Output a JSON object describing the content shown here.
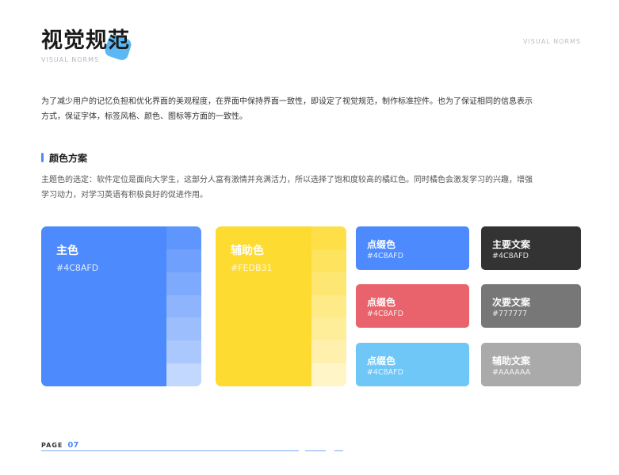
{
  "header": {
    "title": "视觉规范",
    "subtitle": "VISUAL NORMS",
    "corner_label": "VISUAL NORMS",
    "blob_color": "#5bb8f5"
  },
  "intro": "为了减少用户的记忆负担和优化界面的美观程度，在界面中保持界面一致性，即设定了视觉规范，制作标准控件。也为了保证相同的信息表示方式，保证字体，标签风格、颜色、图标等方面的一致性。",
  "section": {
    "title": "颜色方案",
    "desc": "主题色的选定：软件定位是面向大学生，这部分人富有激情并充满活力，所以选择了饱和度较高的橘红色。同时橘色会激发学习的兴趣，增强学习动力，对学习英语有积极良好的促进作用。",
    "accent": "#4c8afd"
  },
  "primary": {
    "name": "主色",
    "hex": "#4C8AFD",
    "color": "#4c8afd",
    "shades": [
      "#5f96fd",
      "#6fa0fd",
      "#7eaafd",
      "#8db4fd",
      "#9cbefd",
      "#abc8fe",
      "#c2d8fe"
    ]
  },
  "secondary": {
    "name": "辅助色",
    "hex": "#FEDB31",
    "color": "#fedb31",
    "shades": [
      "#fedf48",
      "#fee35e",
      "#fee672",
      "#feea86",
      "#feed99",
      "#fff1ad",
      "#fff5c6"
    ]
  },
  "accents": [
    {
      "name": "点缀色",
      "hex": "#4C8AFD",
      "color": "#4c8afd"
    },
    {
      "name": "点缀色",
      "hex": "#4C8AFD",
      "color": "#e8636b"
    },
    {
      "name": "点缀色",
      "hex": "#4C8AFD",
      "color": "#6ec7f6"
    }
  ],
  "text_colors": [
    {
      "name": "主要文案",
      "hex": "#4C8AFD",
      "color": "#333333"
    },
    {
      "name": "次要文案",
      "hex": "#777777",
      "color": "#777777"
    },
    {
      "name": "辅助文案",
      "hex": "#AAAAAA",
      "color": "#aaaaaa"
    }
  ],
  "footer": {
    "page_label": "PAGE",
    "page_number": "07",
    "line_color": "#7aa6f0"
  }
}
